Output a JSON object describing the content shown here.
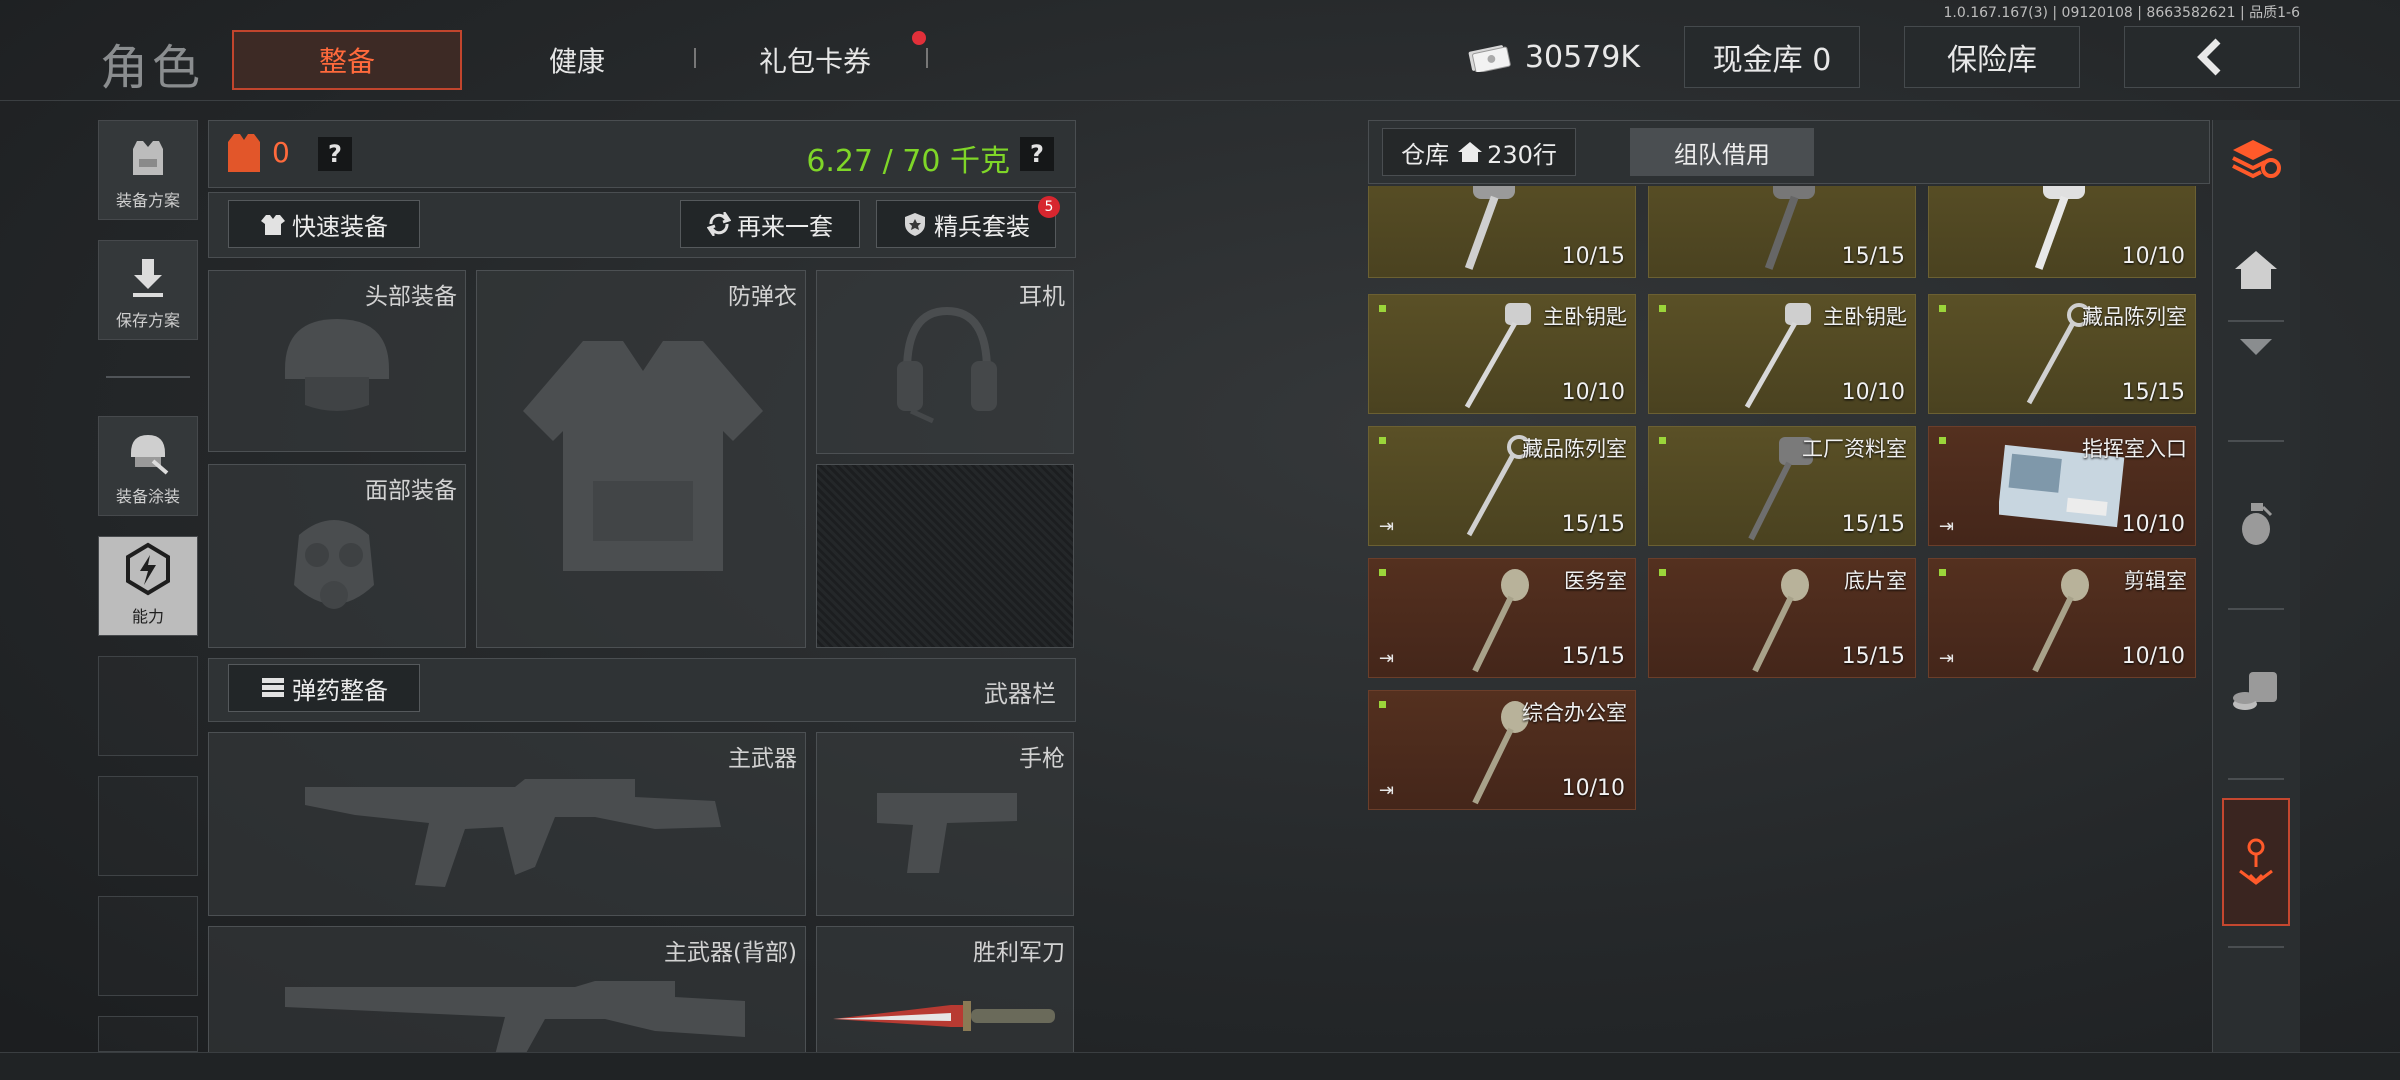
{
  "version": "1.0.167.167(3) | 09120108 | 8663582621 | 品质1-6",
  "header": {
    "title": "角色",
    "tabs": [
      {
        "label": "整备",
        "active": true
      },
      {
        "label": "健康",
        "active": false
      },
      {
        "label": "礼包卡券",
        "active": false
      }
    ],
    "money": "30579K",
    "cash_vault": "现金库 0",
    "insurance": "保险库",
    "accent_color": "#ff6a3c"
  },
  "left_nav": [
    {
      "label": "装备方案",
      "icon": "vest-icon"
    },
    {
      "label": "保存方案",
      "icon": "download-icon"
    },
    {
      "label": "装备涂装",
      "icon": "helmet-icon"
    },
    {
      "label": "能力",
      "icon": "ability-icon",
      "active": true
    }
  ],
  "gear": {
    "armor_value": "0",
    "weight": "6.27 / 70 千克",
    "weight_color": "#7fd628",
    "quick_equip": "快速装备",
    "again": "再来一套",
    "elite_set": "精兵套装",
    "elite_badge": "5",
    "slots": {
      "head": "头部装备",
      "armor": "防弹衣",
      "earphone": "耳机",
      "face": "面部装备"
    },
    "ammo_btn": "弹药整备",
    "weapon_bar": "武器栏",
    "weapons": {
      "primary": "主武器",
      "pistol": "手枪",
      "primary_back": "主武器(背部)",
      "knife": "胜利军刀"
    }
  },
  "warehouse": {
    "tab_label": "仓库",
    "rows": "230行",
    "team_borrow": "组队借用",
    "items": [
      {
        "name": "",
        "count": "10/15",
        "color": "gold"
      },
      {
        "name": "",
        "count": "15/15",
        "color": "gold"
      },
      {
        "name": "",
        "count": "10/10",
        "color": "gold"
      },
      {
        "name": "主卧钥匙",
        "count": "10/10",
        "color": "gold"
      },
      {
        "name": "主卧钥匙",
        "count": "10/10",
        "color": "gold"
      },
      {
        "name": "藏品陈列室",
        "count": "15/15",
        "color": "gold"
      },
      {
        "name": "藏品陈列室",
        "count": "15/15",
        "color": "gold"
      },
      {
        "name": "工厂资料室",
        "count": "15/15",
        "color": "gold"
      },
      {
        "name": "指挥室入口",
        "count": "10/10",
        "color": "red"
      },
      {
        "name": "医务室",
        "count": "15/15",
        "color": "red"
      },
      {
        "name": "底片室",
        "count": "15/15",
        "color": "red"
      },
      {
        "name": "剪辑室",
        "count": "10/10",
        "color": "red"
      },
      {
        "name": "综合办公室",
        "count": "10/10",
        "color": "red"
      }
    ]
  }
}
